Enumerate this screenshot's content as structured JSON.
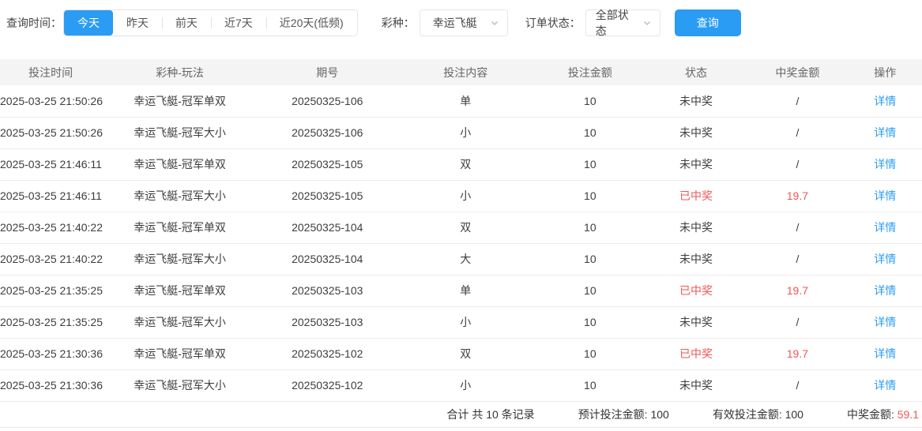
{
  "colors": {
    "accent": "#2b9cf4",
    "danger": "#f25555"
  },
  "filters": {
    "time_label": "查询时间：",
    "time_options": [
      {
        "label": "今天",
        "active": true
      },
      {
        "label": "昨天",
        "active": false
      },
      {
        "label": "前天",
        "active": false
      },
      {
        "label": "近7天",
        "active": false
      },
      {
        "label": "近20天(低频)",
        "active": false
      }
    ],
    "lottery_label": "彩种：",
    "lottery_value": "幸运飞艇",
    "status_label": "订单状态：",
    "status_value": "全部状态",
    "query_button": "查询"
  },
  "table": {
    "headers": [
      "投注时间",
      "彩种-玩法",
      "期号",
      "投注内容",
      "投注金额",
      "状态",
      "中奖金额",
      "操作"
    ],
    "action_label": "详情",
    "rows": [
      {
        "time": "2025-03-25 21:50:26",
        "play": "幸运飞艇-冠军单双",
        "issue": "20250325-106",
        "content": "单",
        "amount": "10",
        "status": "未中奖",
        "win": "/",
        "won": false
      },
      {
        "time": "2025-03-25 21:50:26",
        "play": "幸运飞艇-冠军大小",
        "issue": "20250325-106",
        "content": "小",
        "amount": "10",
        "status": "未中奖",
        "win": "/",
        "won": false
      },
      {
        "time": "2025-03-25 21:46:11",
        "play": "幸运飞艇-冠军单双",
        "issue": "20250325-105",
        "content": "双",
        "amount": "10",
        "status": "未中奖",
        "win": "/",
        "won": false
      },
      {
        "time": "2025-03-25 21:46:11",
        "play": "幸运飞艇-冠军大小",
        "issue": "20250325-105",
        "content": "小",
        "amount": "10",
        "status": "已中奖",
        "win": "19.7",
        "won": true
      },
      {
        "time": "2025-03-25 21:40:22",
        "play": "幸运飞艇-冠军单双",
        "issue": "20250325-104",
        "content": "双",
        "amount": "10",
        "status": "未中奖",
        "win": "/",
        "won": false
      },
      {
        "time": "2025-03-25 21:40:22",
        "play": "幸运飞艇-冠军大小",
        "issue": "20250325-104",
        "content": "大",
        "amount": "10",
        "status": "未中奖",
        "win": "/",
        "won": false
      },
      {
        "time": "2025-03-25 21:35:25",
        "play": "幸运飞艇-冠军单双",
        "issue": "20250325-103",
        "content": "单",
        "amount": "10",
        "status": "已中奖",
        "win": "19.7",
        "won": true
      },
      {
        "time": "2025-03-25 21:35:25",
        "play": "幸运飞艇-冠军大小",
        "issue": "20250325-103",
        "content": "小",
        "amount": "10",
        "status": "未中奖",
        "win": "/",
        "won": false
      },
      {
        "time": "2025-03-25 21:30:36",
        "play": "幸运飞艇-冠军单双",
        "issue": "20250325-102",
        "content": "双",
        "amount": "10",
        "status": "已中奖",
        "win": "19.7",
        "won": true
      },
      {
        "time": "2025-03-25 21:30:36",
        "play": "幸运飞艇-冠军大小",
        "issue": "20250325-102",
        "content": "小",
        "amount": "10",
        "status": "未中奖",
        "win": "/",
        "won": false
      }
    ]
  },
  "summary": {
    "total_text": "合计 共 10 条记录",
    "expected_label": "预计投注金额: ",
    "expected_value": "100",
    "valid_label": "有效投注金额: ",
    "valid_value": "100",
    "win_label": "中奖金额: ",
    "win_value": "59.1"
  }
}
